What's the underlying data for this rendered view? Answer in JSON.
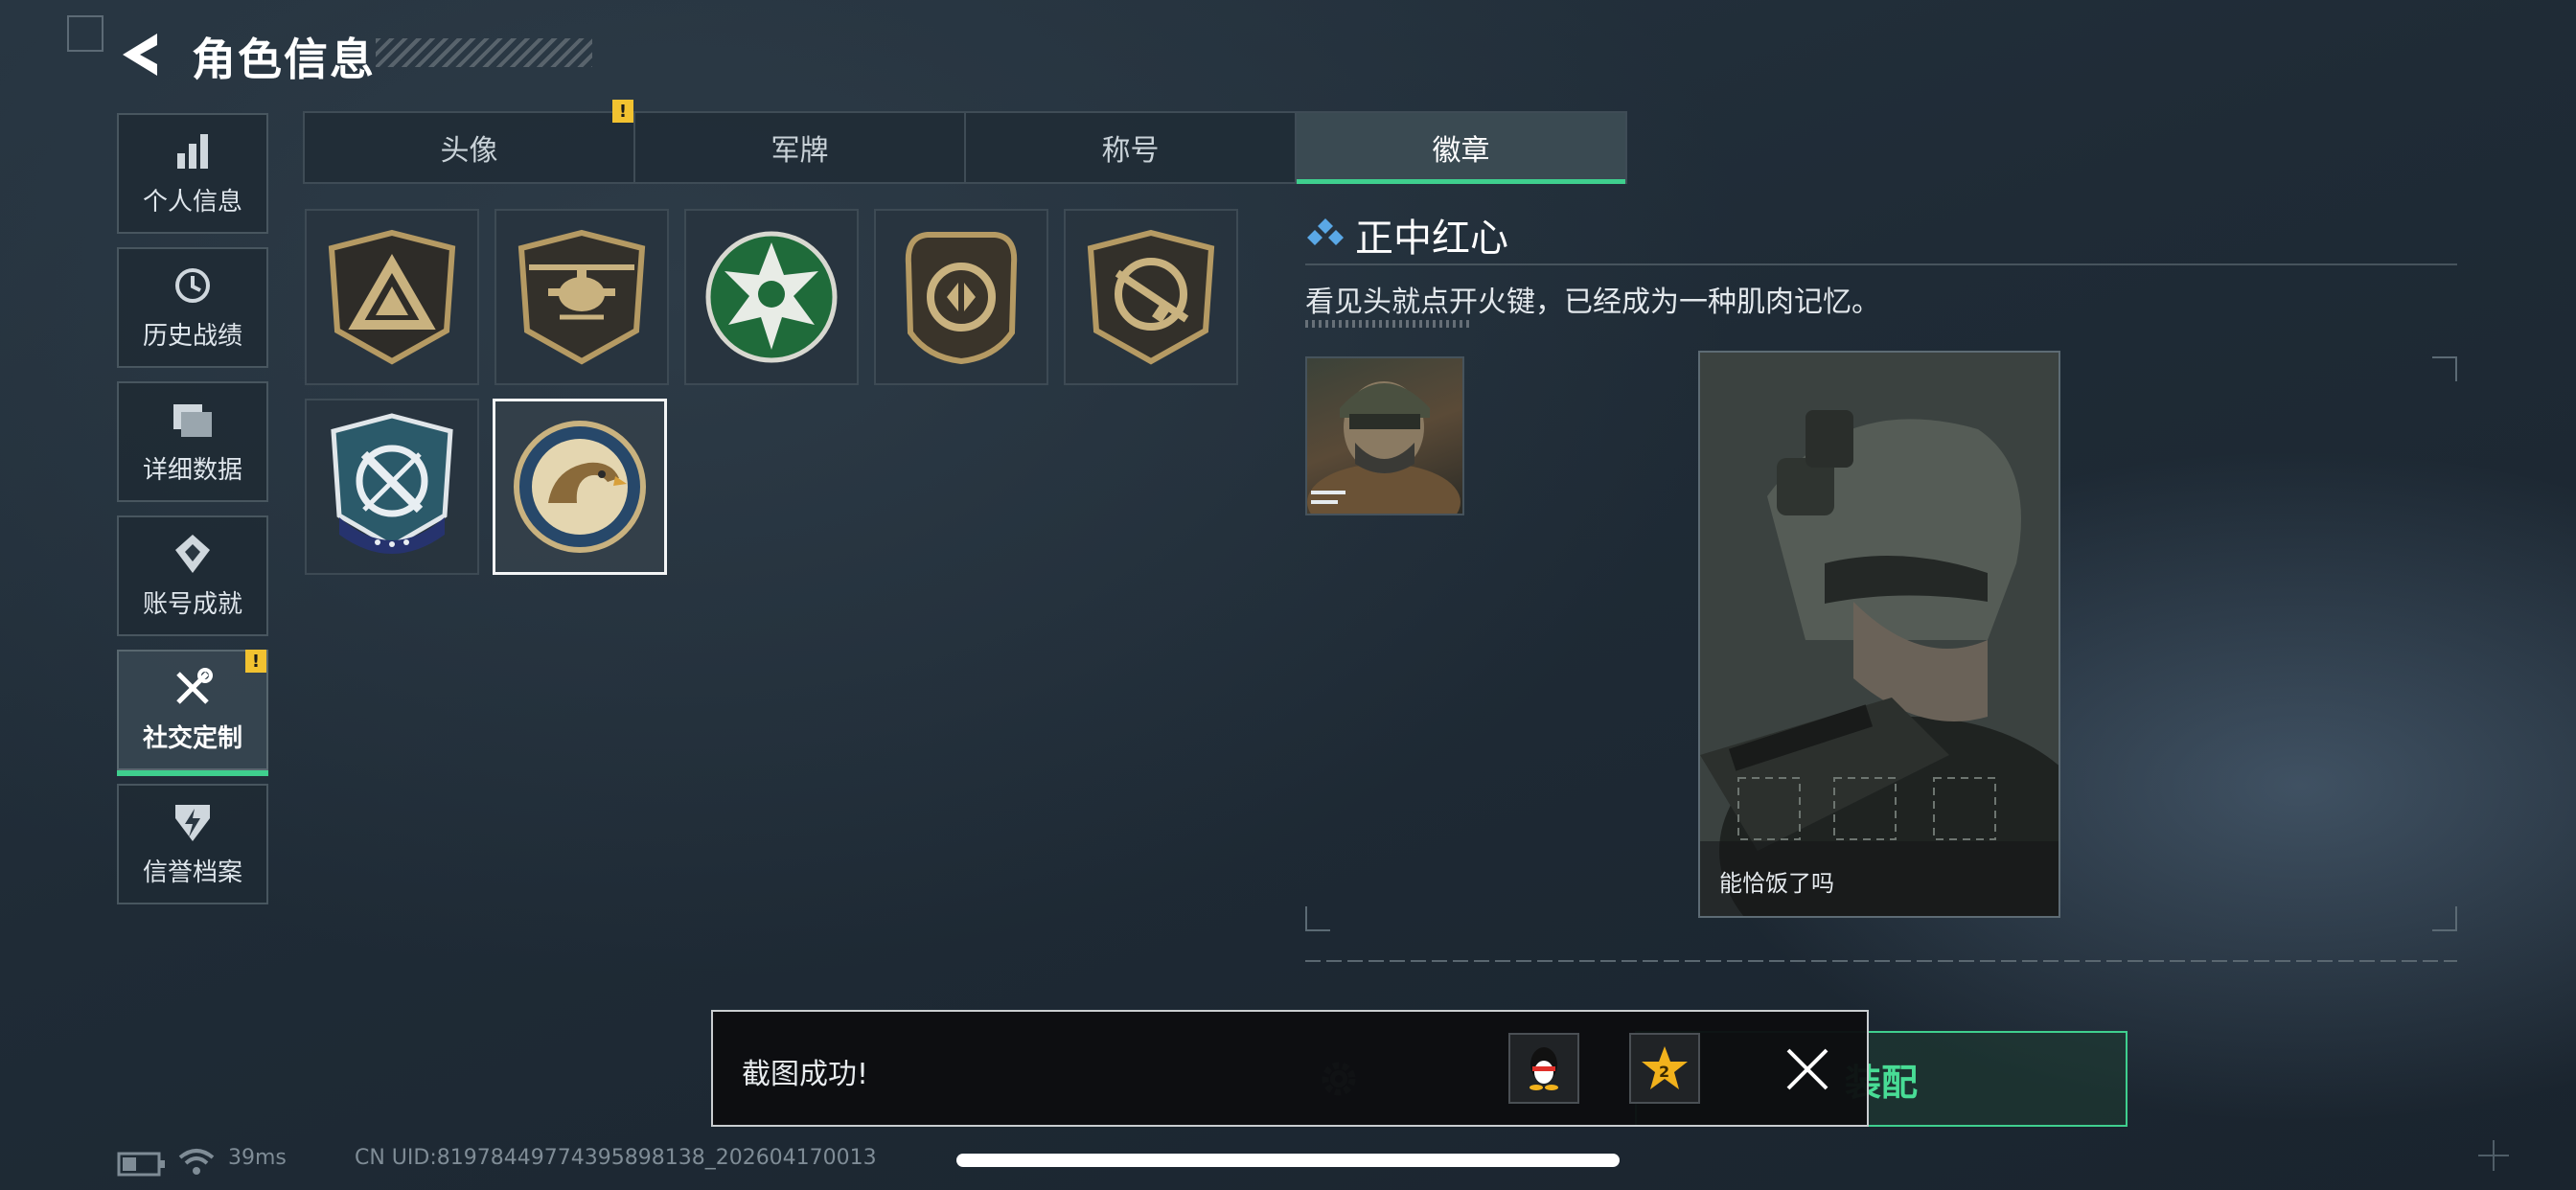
{
  "header": {
    "title": "角色信息",
    "back_icon": "back-arrow-icon"
  },
  "sidebar": {
    "items": [
      {
        "label": "个人信息",
        "icon": "bar-chart-icon",
        "active": false,
        "alert": false
      },
      {
        "label": "历史战绩",
        "icon": "history-clock-icon",
        "active": false,
        "alert": false
      },
      {
        "label": "详细数据",
        "icon": "folder-icon",
        "active": false,
        "alert": false
      },
      {
        "label": "账号成就",
        "icon": "achievement-medal-icon",
        "active": false,
        "alert": false
      },
      {
        "label": "社交定制",
        "icon": "tools-wrench-icon",
        "active": true,
        "alert": true
      },
      {
        "label": "信誉档案",
        "icon": "credit-shield-icon",
        "active": false,
        "alert": false
      }
    ]
  },
  "tabs": [
    {
      "label": "头像",
      "active": false,
      "alert": true
    },
    {
      "label": "军牌",
      "active": false,
      "alert": false
    },
    {
      "label": "称号",
      "active": false,
      "alert": false
    },
    {
      "label": "徽章",
      "active": true,
      "alert": false
    }
  ],
  "alert_mark": "!",
  "badges": [
    {
      "icon": "triangle-emblem-badge-icon",
      "selected": false
    },
    {
      "icon": "helicopter-badge-icon",
      "selected": false
    },
    {
      "icon": "green-star-badge-icon",
      "selected": false
    },
    {
      "icon": "arrows-shield-badge-icon",
      "selected": false
    },
    {
      "icon": "rifle-badge-icon",
      "selected": false
    },
    {
      "icon": "crosshair-blades-badge-icon",
      "selected": false
    },
    {
      "icon": "eagle-badge-icon",
      "selected": true
    }
  ],
  "detail": {
    "title": "正中红心",
    "description": "看见头就点开火键，已经成为一种肌肉记忆。",
    "card_caption": "能恰饭了吗"
  },
  "equip_button_label": "装配",
  "toast": {
    "message": "截图成功!"
  },
  "status_bar": {
    "ping": "39ms",
    "uid": "CN UID:81978449774395898138_202604170013"
  },
  "colors": {
    "accent_green": "#3fcf8e",
    "alert_yellow": "#f2c230",
    "diamond_blue": "#5aa8e6"
  }
}
